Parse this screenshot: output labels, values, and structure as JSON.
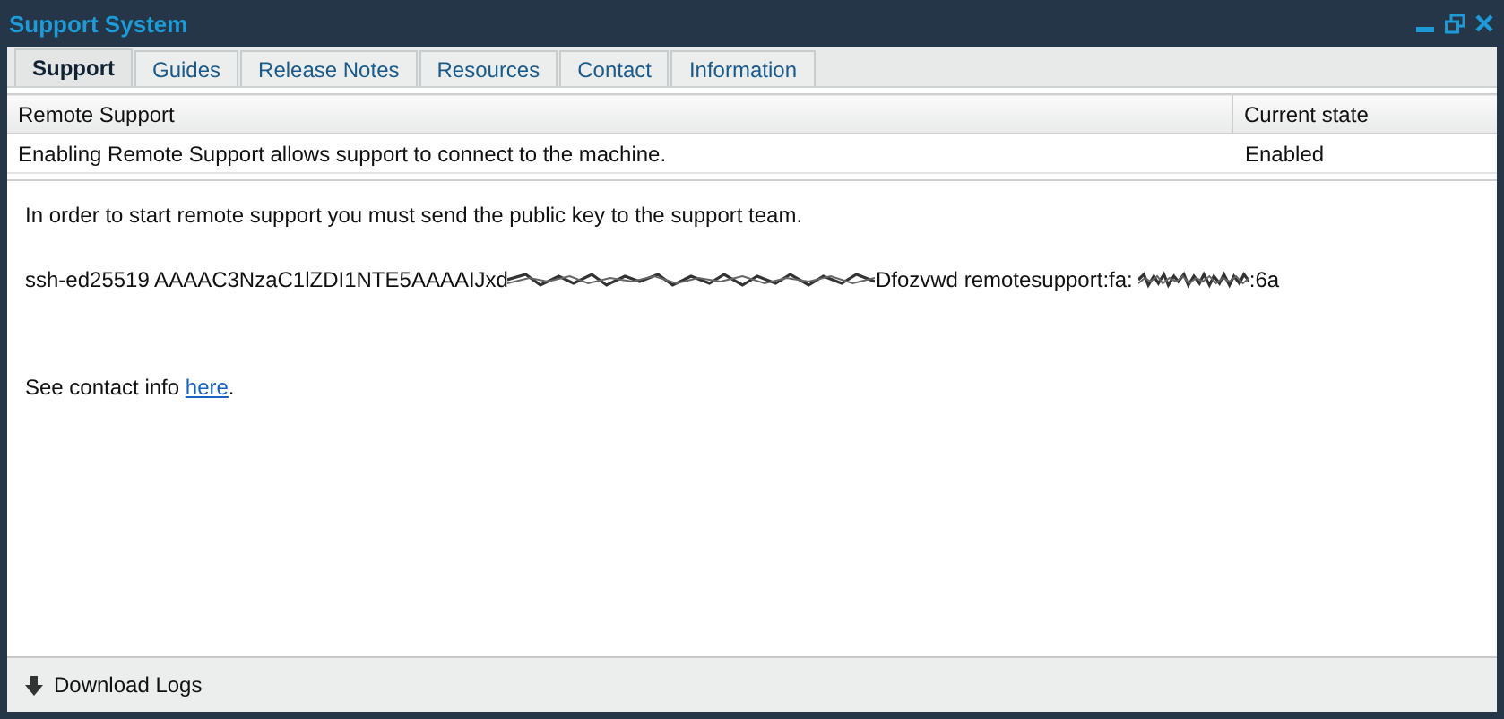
{
  "window": {
    "title": "Support System"
  },
  "tabs": [
    {
      "label": "Support",
      "selected": true
    },
    {
      "label": "Guides",
      "selected": false
    },
    {
      "label": "Release Notes",
      "selected": false
    },
    {
      "label": "Resources",
      "selected": false
    },
    {
      "label": "Contact",
      "selected": false
    },
    {
      "label": "Information",
      "selected": false
    }
  ],
  "table": {
    "columns": [
      "Remote Support",
      "Current state"
    ],
    "rows": [
      [
        "Enabling Remote Support allows support to connect to the machine.",
        "Enabled"
      ]
    ]
  },
  "intro": "In order to start remote support you must send the public key to the support team.",
  "key": [
    {
      "kind": "text",
      "text": "ssh-ed25519 AAAAC3NzaC1lZDI1NTE5AAAAIJxd"
    },
    {
      "kind": "redacted"
    },
    {
      "kind": "text",
      "text": "Dfozvwd remotesupport:fa:"
    },
    {
      "kind": "redacted"
    },
    {
      "kind": "text",
      "text": ":6a"
    }
  ],
  "contact": {
    "text": "See contact info ",
    "link": "here",
    "after": "."
  },
  "footer": {
    "button": "Download Logs"
  }
}
